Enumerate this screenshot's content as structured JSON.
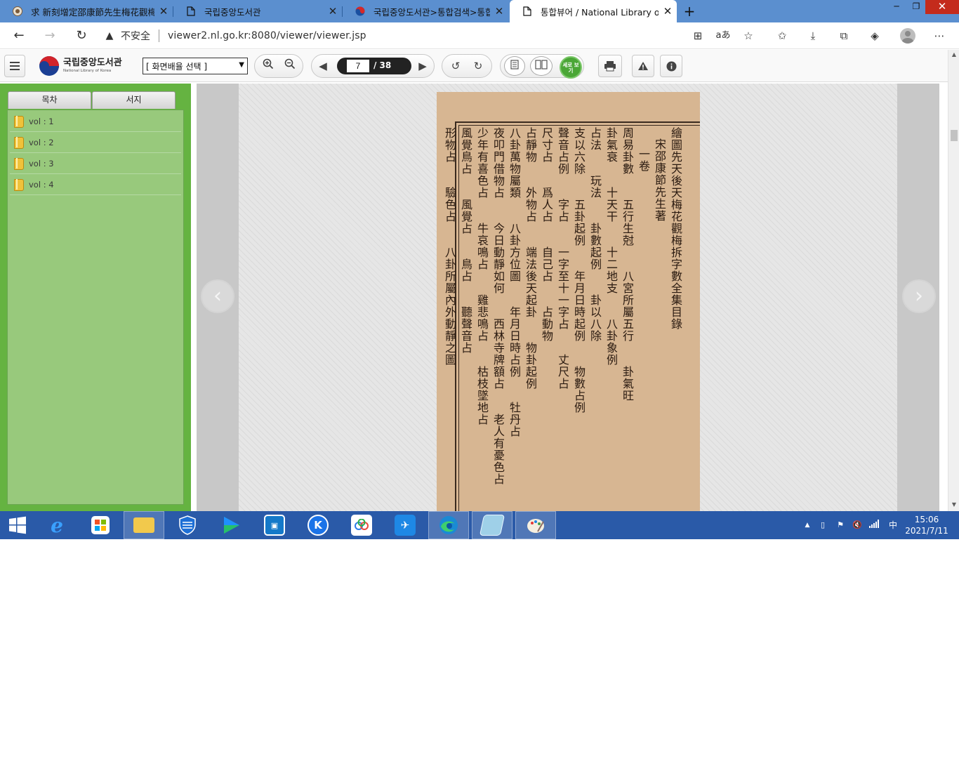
{
  "browser": {
    "tabs": [
      {
        "label": "求 新刻增定邵康節先生梅花觀梅",
        "active": false
      },
      {
        "label": "국립중앙도서관",
        "active": false
      },
      {
        "label": "국립중앙도서관>통합검색>통합",
        "active": false
      },
      {
        "label": "통합뷰어 / National Library of Ko",
        "active": true
      }
    ],
    "new_tab_label": "+",
    "insecure_label": "不安全",
    "url": "viewer2.nl.go.kr:8080/viewer/viewer.jsp"
  },
  "viewer": {
    "logo_korean": "국립중앙도서관",
    "logo_english": "National Library of Korea",
    "layout_select_value": "[ 화면배율 선택 ]",
    "current_page": "7",
    "page_total": "/ 38",
    "vertical_view_label": "세로 보기"
  },
  "sidebar": {
    "tabs": [
      {
        "label": "목차"
      },
      {
        "label": "서지"
      }
    ],
    "items": [
      {
        "label": "vol : 1"
      },
      {
        "label": "vol : 2"
      },
      {
        "label": "vol : 3"
      },
      {
        "label": "vol : 4"
      }
    ]
  },
  "page_text": {
    "columns": [
      "繪圖先天後天梅花觀梅拆字數全集目錄",
      "宋邵康節先生著",
      "一卷",
      "周易卦數　　五行生尅　　八宮所屬五行　　卦氣旺",
      "卦氣衰　　十天干　　十二地支　　八卦象例",
      "占法　　玩法　　卦數起例　　卦以八除",
      "支以六除　　五卦起例　　年月日時起例　　物數占例",
      "聲音占例　　字占　　一字至十一字占　　丈尺占",
      "尺寸占　　爲人占　　自己占　　占動物",
      "占靜物　　外物占　　端法後天起卦　　物卦起例",
      "八卦萬物屬類　　八卦方位圖　　年月日時占例　　牡丹占",
      "夜叩門借物占　　今日動靜如何　　西林寺牌額占　　老人有憂色占",
      "少年有喜色占　　牛哀鳴占　　雞悲鳴占　　枯枝墜地占",
      "風覺鳥占　　風覺占　　鳥占　　聽聲音占",
      "形物占　　驗色占　　八卦所屬內外動靜之圖"
    ]
  },
  "taskbar": {
    "time": "15:06",
    "date": "2021/7/11",
    "ime": "中"
  }
}
